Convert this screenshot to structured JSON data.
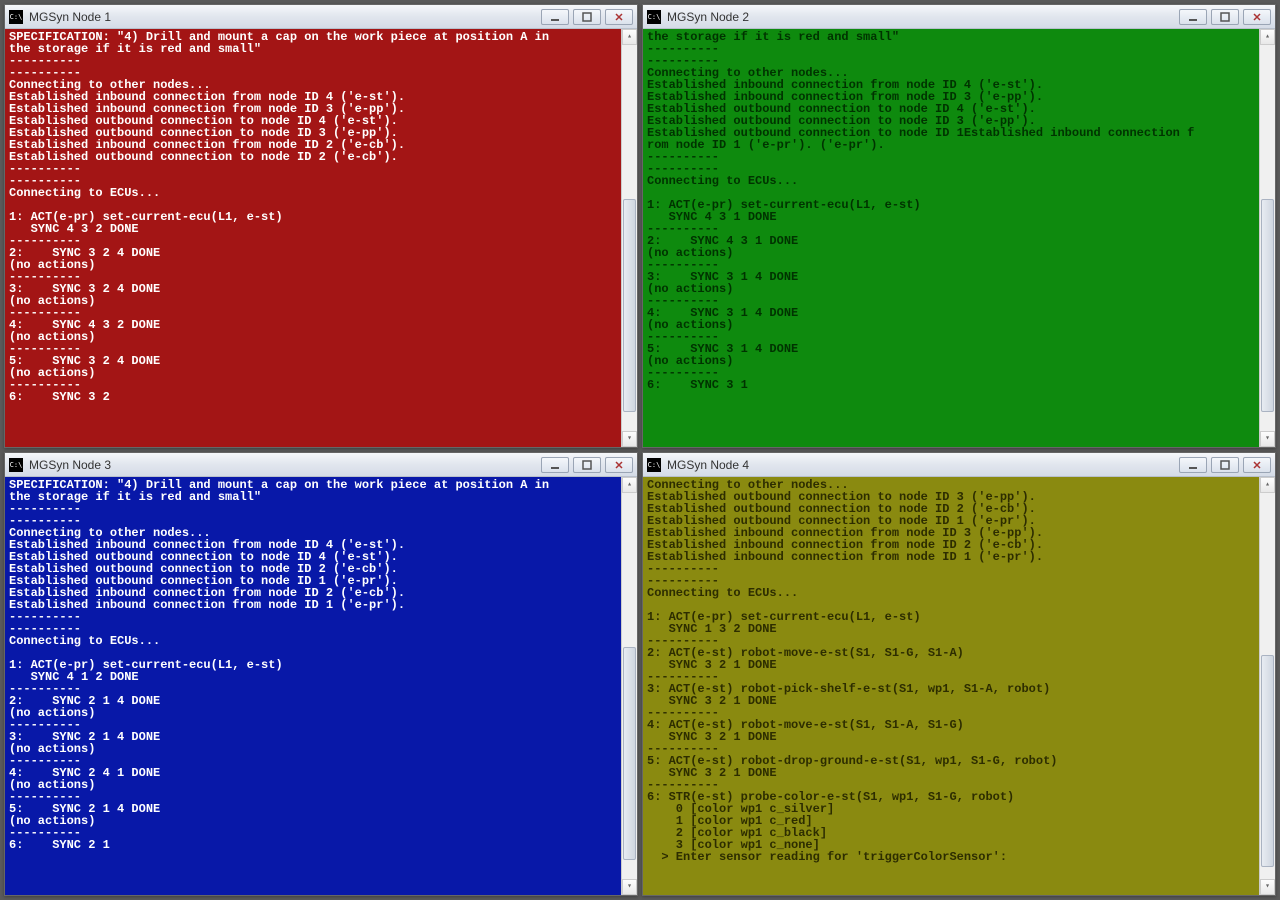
{
  "windows": [
    {
      "title": "MGSyn Node 1",
      "classKey": "node1",
      "scrollThumbTop": "40%",
      "scrollThumbHeight": "55%",
      "lines": [
        "SPECIFICATION: \"4) Drill and mount a cap on the work piece at position A in",
        "the storage if it is red and small\"",
        "----------",
        "----------",
        "Connecting to other nodes...",
        "Established inbound connection from node ID 4 ('e-st').",
        "Established inbound connection from node ID 3 ('e-pp').",
        "Established outbound connection to node ID 4 ('e-st').",
        "Established outbound connection to node ID 3 ('e-pp').",
        "Established inbound connection from node ID 2 ('e-cb').",
        "Established outbound connection to node ID 2 ('e-cb').",
        "----------",
        "----------",
        "Connecting to ECUs...",
        "",
        "1: ACT(e-pr) set-current-ecu(L1, e-st)",
        "   SYNC 4 3 2 DONE",
        "----------",
        "2:    SYNC 3 2 4 DONE",
        "(no actions)",
        "----------",
        "3:    SYNC 3 2 4 DONE",
        "(no actions)",
        "----------",
        "4:    SYNC 4 3 2 DONE",
        "(no actions)",
        "----------",
        "5:    SYNC 3 2 4 DONE",
        "(no actions)",
        "----------",
        "6:    SYNC 3 2"
      ]
    },
    {
      "title": "MGSyn Node 2",
      "classKey": "node2",
      "scrollThumbTop": "40%",
      "scrollThumbHeight": "55%",
      "lines": [
        "the storage if it is red and small\"",
        "----------",
        "----------",
        "Connecting to other nodes...",
        "Established inbound connection from node ID 4 ('e-st').",
        "Established inbound connection from node ID 3 ('e-pp').",
        "Established outbound connection to node ID 4 ('e-st').",
        "Established outbound connection to node ID 3 ('e-pp').",
        "Established outbound connection to node ID 1Established inbound connection f",
        "rom node ID 1 ('e-pr'). ('e-pr').",
        "----------",
        "----------",
        "Connecting to ECUs...",
        "",
        "1: ACT(e-pr) set-current-ecu(L1, e-st)",
        "   SYNC 4 3 1 DONE",
        "----------",
        "2:    SYNC 4 3 1 DONE",
        "(no actions)",
        "----------",
        "3:    SYNC 3 1 4 DONE",
        "(no actions)",
        "----------",
        "4:    SYNC 3 1 4 DONE",
        "(no actions)",
        "----------",
        "5:    SYNC 3 1 4 DONE",
        "(no actions)",
        "----------",
        "6:    SYNC 3 1"
      ]
    },
    {
      "title": "MGSyn Node 3",
      "classKey": "node3",
      "scrollThumbTop": "40%",
      "scrollThumbHeight": "55%",
      "lines": [
        "SPECIFICATION: \"4) Drill and mount a cap on the work piece at position A in",
        "the storage if it is red and small\"",
        "----------",
        "----------",
        "Connecting to other nodes...",
        "Established inbound connection from node ID 4 ('e-st').",
        "Established outbound connection to node ID 4 ('e-st').",
        "Established outbound connection to node ID 2 ('e-cb').",
        "Established outbound connection to node ID 1 ('e-pr').",
        "Established inbound connection from node ID 2 ('e-cb').",
        "Established inbound connection from node ID 1 ('e-pr').",
        "----------",
        "----------",
        "Connecting to ECUs...",
        "",
        "1: ACT(e-pr) set-current-ecu(L1, e-st)",
        "   SYNC 4 1 2 DONE",
        "----------",
        "2:    SYNC 2 1 4 DONE",
        "(no actions)",
        "----------",
        "3:    SYNC 2 1 4 DONE",
        "(no actions)",
        "----------",
        "4:    SYNC 2 4 1 DONE",
        "(no actions)",
        "----------",
        "5:    SYNC 2 1 4 DONE",
        "(no actions)",
        "----------",
        "6:    SYNC 2 1"
      ]
    },
    {
      "title": "MGSyn Node 4",
      "classKey": "node4",
      "scrollThumbTop": "42%",
      "scrollThumbHeight": "55%",
      "lines": [
        "Connecting to other nodes...",
        "Established outbound connection to node ID 3 ('e-pp').",
        "Established outbound connection to node ID 2 ('e-cb').",
        "Established outbound connection to node ID 1 ('e-pr').",
        "Established inbound connection from node ID 3 ('e-pp').",
        "Established inbound connection from node ID 2 ('e-cb').",
        "Established inbound connection from node ID 1 ('e-pr').",
        "----------",
        "----------",
        "Connecting to ECUs...",
        "",
        "1: ACT(e-pr) set-current-ecu(L1, e-st)",
        "   SYNC 1 3 2 DONE",
        "----------",
        "2: ACT(e-st) robot-move-e-st(S1, S1-G, S1-A)",
        "   SYNC 3 2 1 DONE",
        "----------",
        "3: ACT(e-st) robot-pick-shelf-e-st(S1, wp1, S1-A, robot)",
        "   SYNC 3 2 1 DONE",
        "----------",
        "4: ACT(e-st) robot-move-e-st(S1, S1-A, S1-G)",
        "   SYNC 3 2 1 DONE",
        "----------",
        "5: ACT(e-st) robot-drop-ground-e-st(S1, wp1, S1-G, robot)",
        "   SYNC 3 2 1 DONE",
        "----------",
        "6: STR(e-st) probe-color-e-st(S1, wp1, S1-G, robot)",
        "    0 [color wp1 c_silver]",
        "    1 [color wp1 c_red]",
        "    2 [color wp1 c_black]",
        "    3 [color wp1 c_none]",
        "  > Enter sensor reading for 'triggerColorSensor':"
      ]
    }
  ],
  "icons": {
    "cmd": "C:\\"
  }
}
